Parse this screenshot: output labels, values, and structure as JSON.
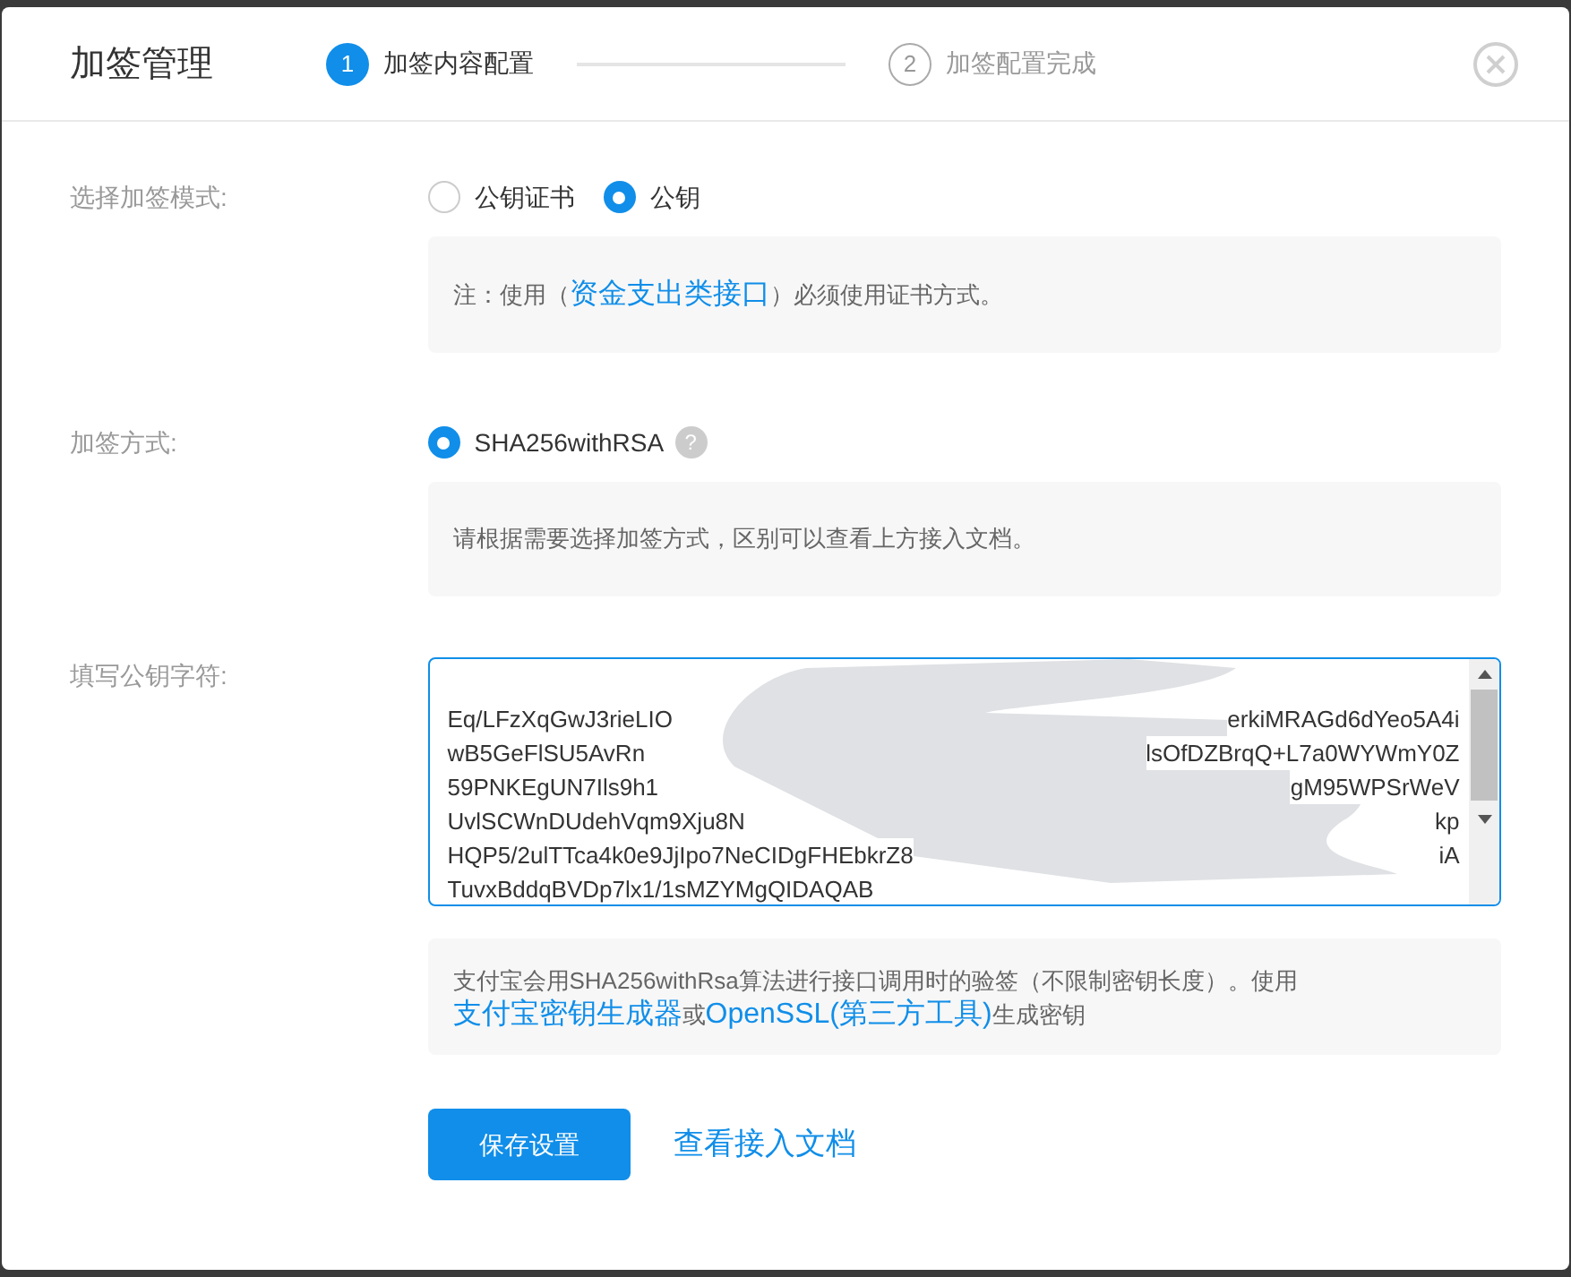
{
  "dialog": {
    "title": "加签管理"
  },
  "steps": [
    {
      "number": "1",
      "label": "加签内容配置",
      "selected": true
    },
    {
      "number": "2",
      "label": "加签配置完成",
      "selected": false
    }
  ],
  "mode": {
    "label": "选择加签模式:",
    "options": [
      {
        "label": "公钥证书",
        "selected": false
      },
      {
        "label": "公钥",
        "selected": true
      }
    ],
    "note": {
      "before": "注：使用（",
      "link": "资金支出类接口",
      "after": "）必须使用证书方式。"
    }
  },
  "algorithm": {
    "label": "加签方式:",
    "options": [
      {
        "label": "SHA256withRSA",
        "selected": true
      }
    ],
    "help": "?",
    "note": "请根据需要选择加签方式，区别可以查看上方接入文档。"
  },
  "key": {
    "label": "填写公钥字符:",
    "lines": [
      {
        "left": "Eq/LFzXqGwJ3rieLIO",
        "right": "erkiMRAGd6dYeo5A4i"
      },
      {
        "left": "wB5GeFlSU5AvRn",
        "right": "lsOfDZBrqQ+L7a0WYWmY0Z"
      },
      {
        "left": "59PNKEgUN7Ils9h1",
        "right": "gM95WPSrWeV"
      },
      {
        "left": "UvlSCWnDUdehVqm9Xju8N",
        "right": "kp"
      },
      {
        "left": "HQP5/2ulTTca4k0e9JjIpo7NeCIDgFHEbkrZ8",
        "right": "iA"
      },
      {
        "left": "TuvxBddqBVDp7lx1/1sMZYMgQIDAQAB"
      }
    ],
    "note": {
      "before": "支付宝会用SHA256withRsa算法进行接口调用时的验签（不限制密钥长度）。使用",
      "link1": "支付宝密钥生成器",
      "middle": "或",
      "link2": "OpenSSL(第三方工具)",
      "after": "生成密钥"
    }
  },
  "actions": {
    "save": "保存设置",
    "docs": "查看接入文档"
  }
}
